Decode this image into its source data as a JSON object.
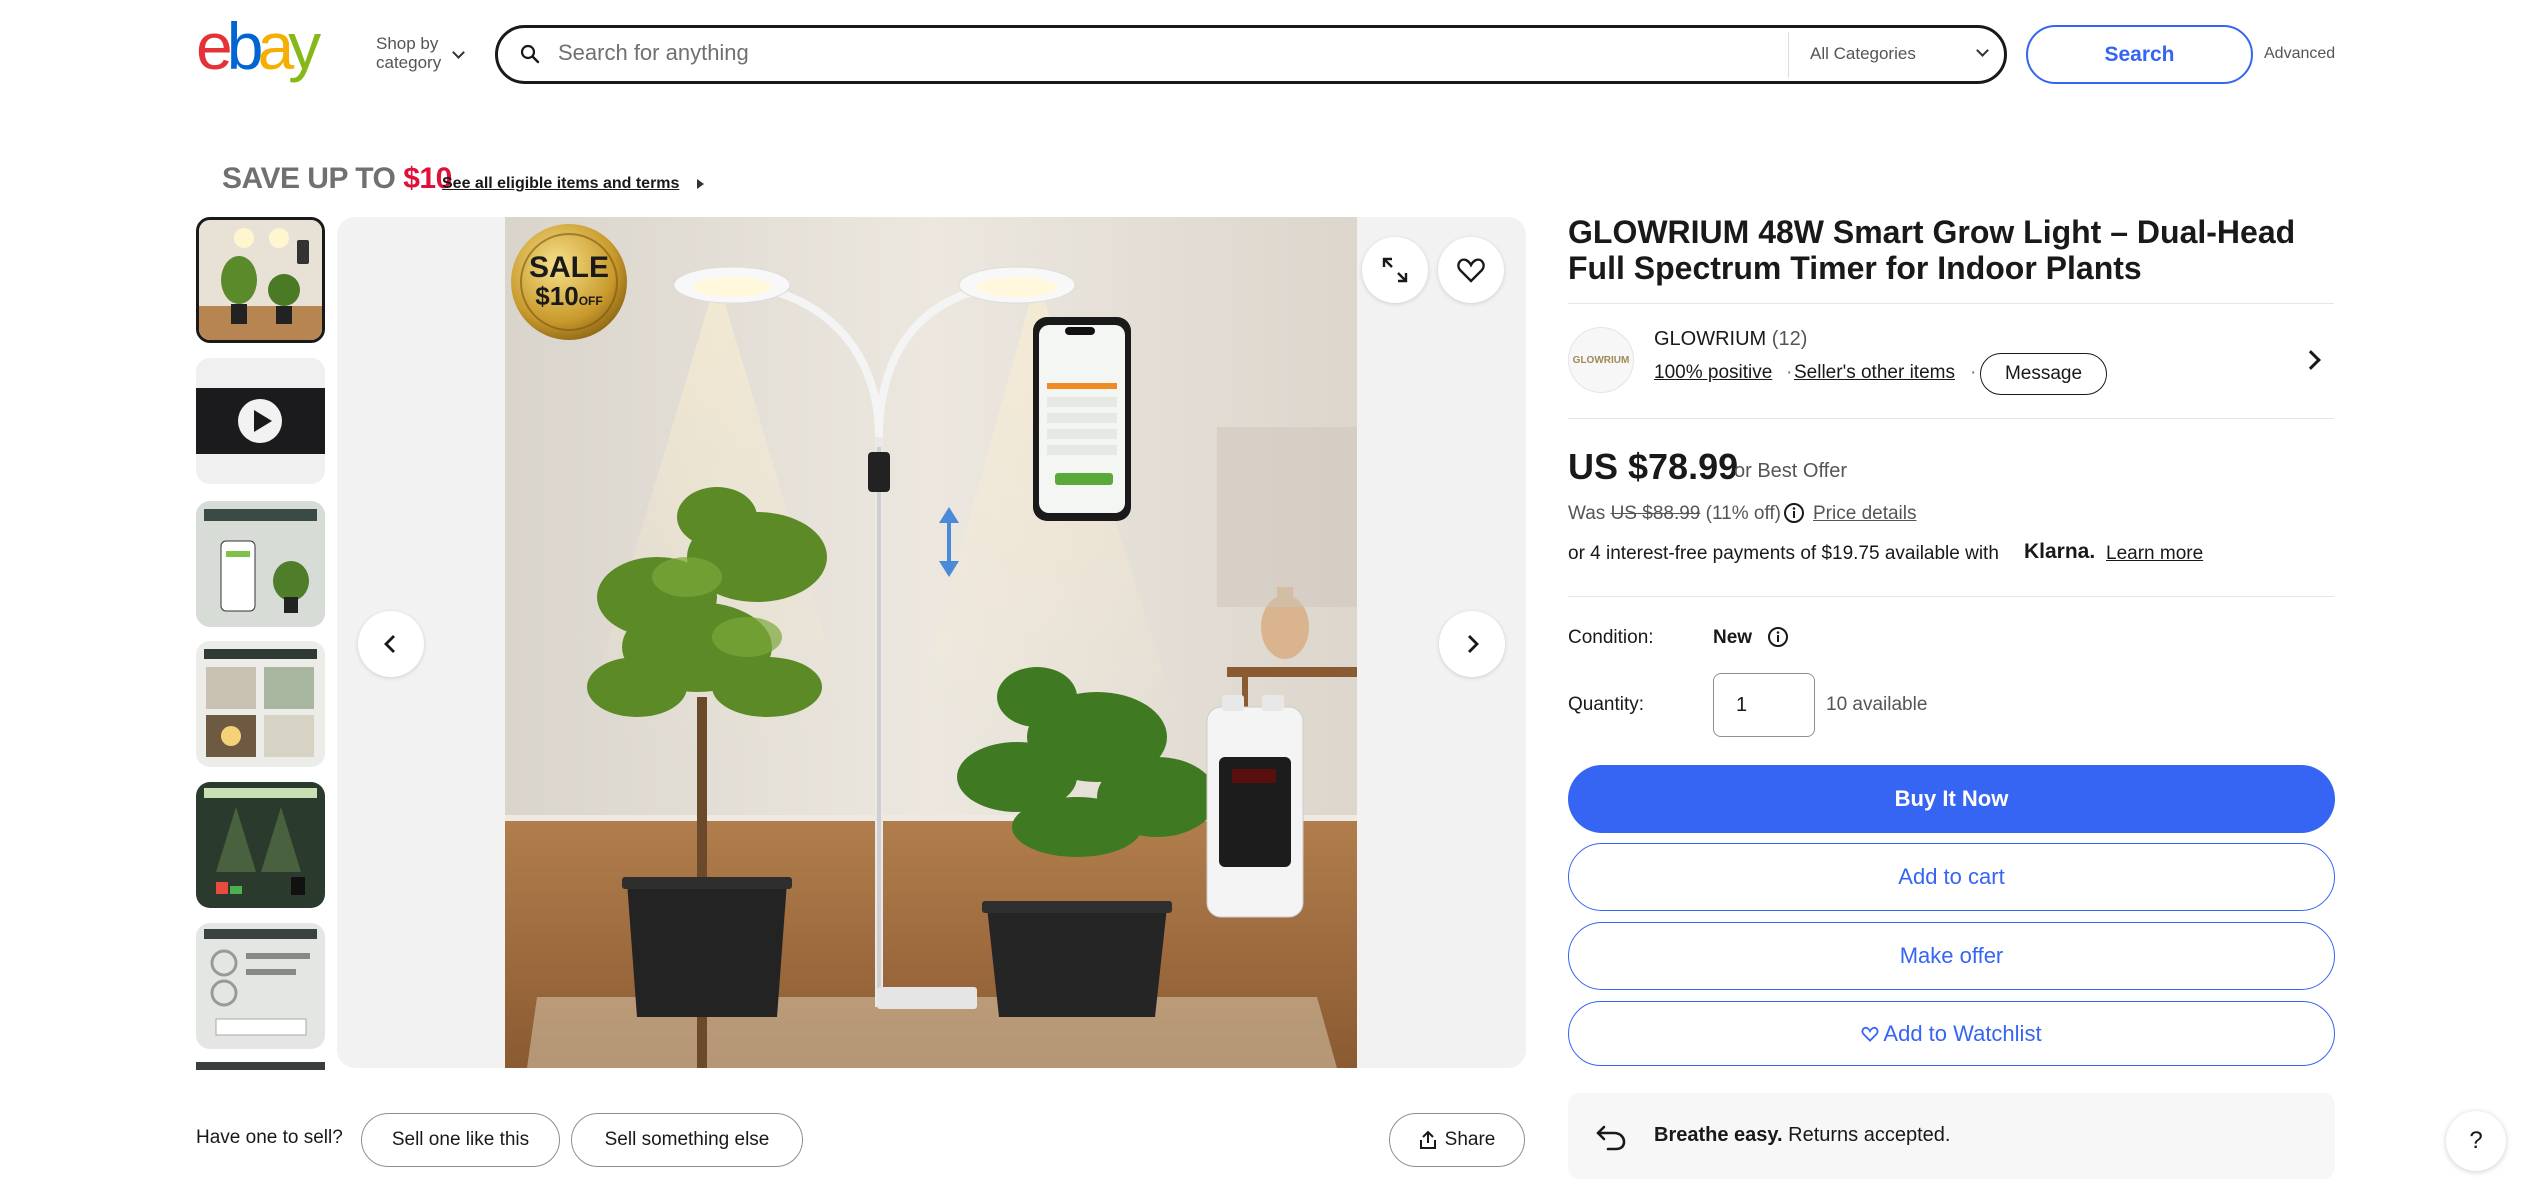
{
  "header": {
    "logo_letters": [
      "e",
      "b",
      "a",
      "y"
    ],
    "logo_colors": [
      "#e53238",
      "#0064d2",
      "#f5af02",
      "#86b817"
    ],
    "shop_by_line1": "Shop by",
    "shop_by_line2": "category",
    "search_placeholder": "Search for anything",
    "category_select": "All Categories",
    "search_button": "Search",
    "advanced_link": "Advanced"
  },
  "promo": {
    "save_text": "SAVE UP TO ",
    "save_amount": "$10",
    "see_all": "See all eligible items and terms"
  },
  "gallery": {
    "thumbnail_count": 6,
    "selected_index": 0,
    "badge_top": "SALE",
    "badge_bottom": "$10",
    "badge_off": "OFF"
  },
  "product": {
    "title": "GLOWRIUM 48W Smart Grow Light – Dual-Head Full Spectrum Timer for Indoor Plants",
    "seller_logo": "GLOWRIUM",
    "seller_name": "GLOWRIUM",
    "seller_feedback": "(12)",
    "seller_positive": "100% positive",
    "seller_sep": "·",
    "seller_other": "Seller's other items",
    "message_button": "Message",
    "price": "US $78.99",
    "best_offer": "or Best Offer",
    "was_label": "Was ",
    "was_price": "US $88.99",
    "discount": " (11% off)",
    "price_details": "Price details",
    "klarna_text": "or 4 interest-free payments of $19.75 available with",
    "klarna_brand": "Klarna.",
    "learn_more": "Learn more",
    "condition_label": "Condition:",
    "condition_value": "New",
    "quantity_label": "Quantity:",
    "quantity_value": "1",
    "available": "10 available",
    "buy_now": "Buy It Now",
    "add_to_cart": "Add to cart",
    "make_offer": "Make offer",
    "add_to_watchlist": "Add to Watchlist",
    "returns_bold": "Breathe easy.",
    "returns_text": " Returns accepted."
  },
  "bottom": {
    "have_one": "Have one to sell?",
    "sell_like": "Sell one like this",
    "sell_else": "Sell something else",
    "share": "Share",
    "help": "?"
  },
  "colors": {
    "accent": "#3665f3",
    "save_red": "#e0103a"
  }
}
